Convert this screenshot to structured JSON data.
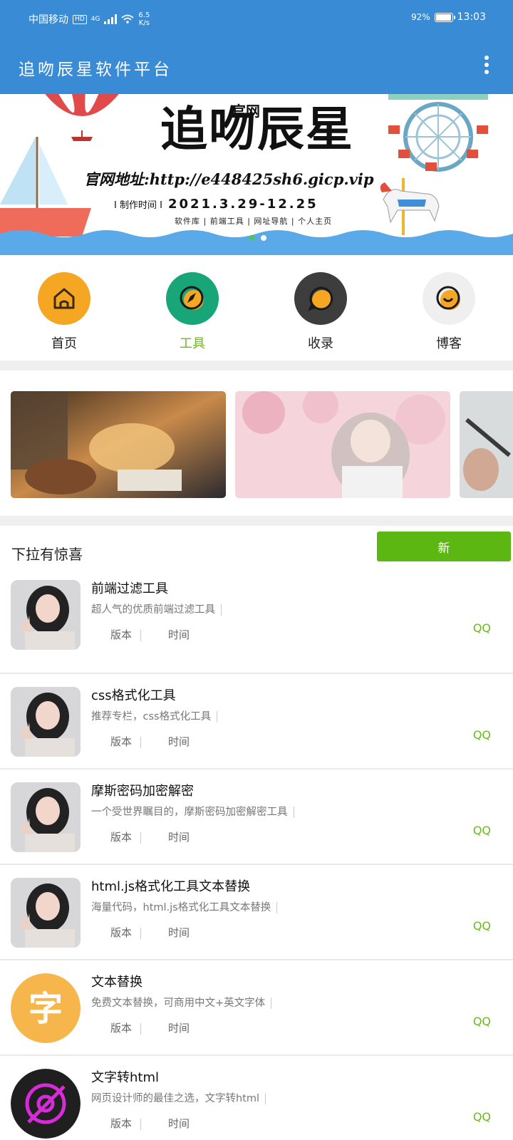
{
  "status_bar": {
    "carrier": "中国移动",
    "hd": "HD",
    "net": "4G",
    "speed_value": "6.5",
    "speed_unit": "K/s",
    "battery": "92%",
    "time": "13:03"
  },
  "app_bar": {
    "title": "追吻辰星软件平台",
    "menu_icon": "more-vert-icon"
  },
  "banner": {
    "title": "追吻辰星",
    "subtitle": "官网",
    "url_label": "官网地址:http://e448425sh6.gicp.vip",
    "date_label": "I 制作时间 I",
    "date_range": "2021.3.29-12.25",
    "links": "软件库 | 前端工具 | 网址导航 | 个人主页",
    "pager_active": 0,
    "pager_count": 2
  },
  "nav": [
    {
      "label": "首页",
      "icon": "home-icon",
      "color": "#f5a623",
      "active": false
    },
    {
      "label": "工具",
      "icon": "compass-icon",
      "color": "#18a678",
      "active": true
    },
    {
      "label": "收录",
      "icon": "chat-bubble-icon",
      "color": "#3d3d3d",
      "active": false
    },
    {
      "label": "博客",
      "icon": "smile-icon",
      "color": "#efefef",
      "active": false
    }
  ],
  "section": {
    "title": "下拉有惊喜",
    "new_button": "新"
  },
  "list": [
    {
      "title": "前端过滤工具",
      "desc": "超人气的优质前端过滤工具",
      "version_label": "版本",
      "time_label": "时间",
      "action": "QQ",
      "thumb": "avatar-photo"
    },
    {
      "title": "css格式化工具",
      "desc": "推荐专栏，css格式化工具",
      "version_label": "版本",
      "time_label": "时间",
      "action": "QQ",
      "thumb": "avatar-photo"
    },
    {
      "title": "摩斯密码加密解密",
      "desc": "一个受世界瞩目的，摩斯密码加密解密工具",
      "version_label": "版本",
      "time_label": "时间",
      "action": "QQ",
      "thumb": "avatar-photo"
    },
    {
      "title": "html.js格式化工具文本替换",
      "desc": "海量代码，html.js格式化工具文本替换",
      "version_label": "版本",
      "time_label": "时间",
      "action": "QQ",
      "thumb": "avatar-photo"
    },
    {
      "title": "文本替换",
      "desc": "免费文本替换，可商用中文+英文字体",
      "version_label": "版本",
      "time_label": "时间",
      "action": "QQ",
      "thumb": "char-icon",
      "thumb_char": "字"
    },
    {
      "title": "文字转html",
      "desc": "网页设计师的最佳之选，文字转html",
      "version_label": "版本",
      "time_label": "时间",
      "action": "QQ",
      "thumb": "atom-icon"
    }
  ]
}
